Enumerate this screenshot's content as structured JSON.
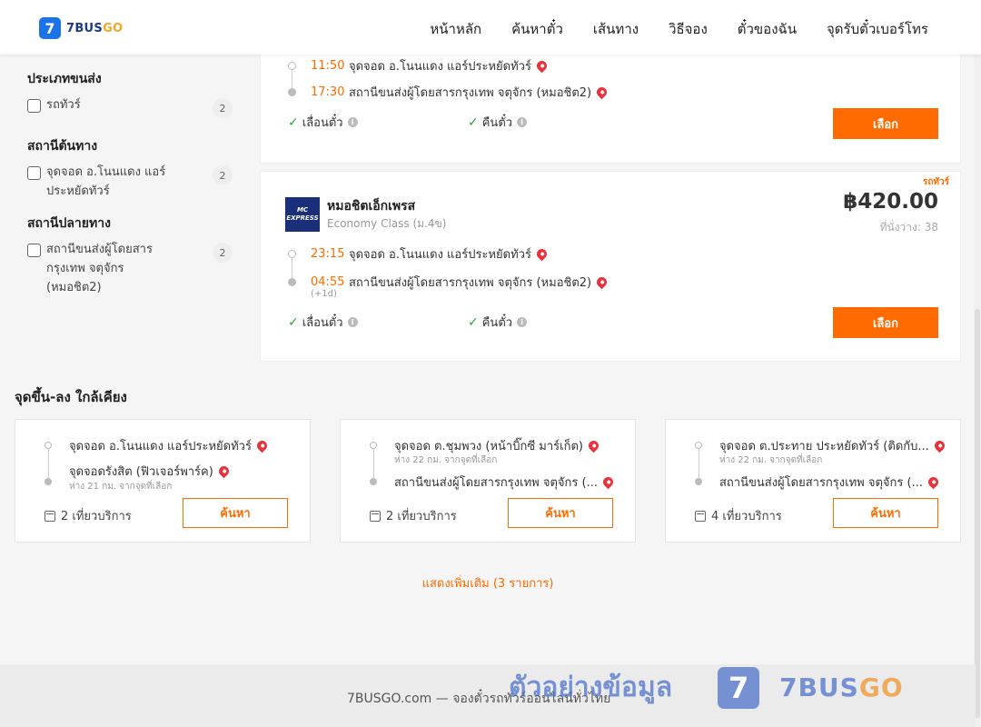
{
  "header": {
    "logo_num": "7",
    "logo_main": "7BUS",
    "logo_accent": "GO",
    "nav": [
      "หน้าหลัก",
      "ค้นหาตั๋ว",
      "เส้นทาง",
      "วิธีจอง",
      "ตั๋วของฉัน",
      "จุดรับตั๋วเบอร์โทร"
    ]
  },
  "filters": {
    "type": {
      "title": "ประเภทขนส่ง",
      "label": "รถทัวร์",
      "count": "2"
    },
    "origin": {
      "title": "สถานีต้นทาง",
      "label": "จุดจอด อ.โนนแดง แอร์ประหยัดทัวร์",
      "count": "2"
    },
    "destination": {
      "title": "สถานีปลายทาง",
      "label": "สถานีขนส่งผู้โดยสารกรุงเทพ จตุจักร (หมอชิต2)",
      "count": "2"
    }
  },
  "trip1": {
    "dep_time": "11:50",
    "dep_stop": "จุดจอด อ.โนนแดง แอร์ประหยัดทัวร์",
    "arr_time": "17:30",
    "arr_stop": "สถานีขนส่งผู้โดยสารกรุงเทพ จตุจักร (หมอชิต2)",
    "reschedule": "เลื่อนตั๋ว",
    "refund": "คืนตั๋ว",
    "select": "เลือก"
  },
  "trip2": {
    "tag": "รถทัวร์",
    "operator_logo": "MC EXPRESS",
    "operator": "หมอชิตเอ็กเพรส",
    "class": "Economy Class (ม.4ข)",
    "price": "฿420.00",
    "seats": "ที่นั่งว่าง: 38",
    "dep_time": "23:15",
    "dep_stop": "จุดจอด อ.โนนแดง แอร์ประหยัดทัวร์",
    "arr_time": "04:55",
    "arr_stop": "สถานีขนส่งผู้โดยสารกรุงเทพ จตุจักร (หมอชิต2)",
    "next_day": "(+1d)",
    "reschedule": "เลื่อนตั๋ว",
    "refund": "คืนตั๋ว",
    "select": "เลือก"
  },
  "nearby": {
    "title": "จุดขึ้น-ลง ใกล้เคียง",
    "cards": [
      {
        "from": "จุดจอด อ.โนนแดง แอร์ประหยัดทัวร์",
        "from_dist": "",
        "to": "จุดจอดรังสิต (ฟิวเจอร์พาร์ค)",
        "to_dist": "ห่าง 21 กม. จากจุดที่เลือก",
        "trips": "2 เที่ยวบริการ",
        "search": "ค้นหา"
      },
      {
        "from": "จุดจอด ต.ชุมพวง (หน้าบิ๊กซี มาร์เก็ต)",
        "from_dist": "ห่าง 22 กม. จากจุดที่เลือก",
        "to": "สถานีขนส่งผู้โดยสารกรุงเทพ จตุจักร (...",
        "to_dist": "",
        "trips": "2 เที่ยวบริการ",
        "search": "ค้นหา"
      },
      {
        "from": "จุดจอด ต.ประทาย ประหยัดทัวร์ (ติดกับ...",
        "from_dist": "ห่าง 22 กม. จากจุดที่เลือก",
        "to": "สถานีขนส่งผู้โดยสารกรุงเทพ จตุจักร (...",
        "to_dist": "",
        "trips": "4 เที่ยวบริการ",
        "search": "ค้นหา"
      }
    ]
  },
  "show_more": "แสดงเพิ่มเติม (3 รายการ)",
  "footer": {
    "text": "7BUSGO.com — จองตั๋วรถทัวร์ออนไลน์ทั่วไทย",
    "watermark": "ตัวอย่างข้อมูล",
    "wm_logo": "7",
    "wm_brand_main": "7BUS",
    "wm_brand_accent": "GO"
  },
  "colors": {
    "accent": "#ff6b00",
    "brand": "#1a73e8",
    "check": "#2aa836",
    "pin": "#e8323c"
  }
}
